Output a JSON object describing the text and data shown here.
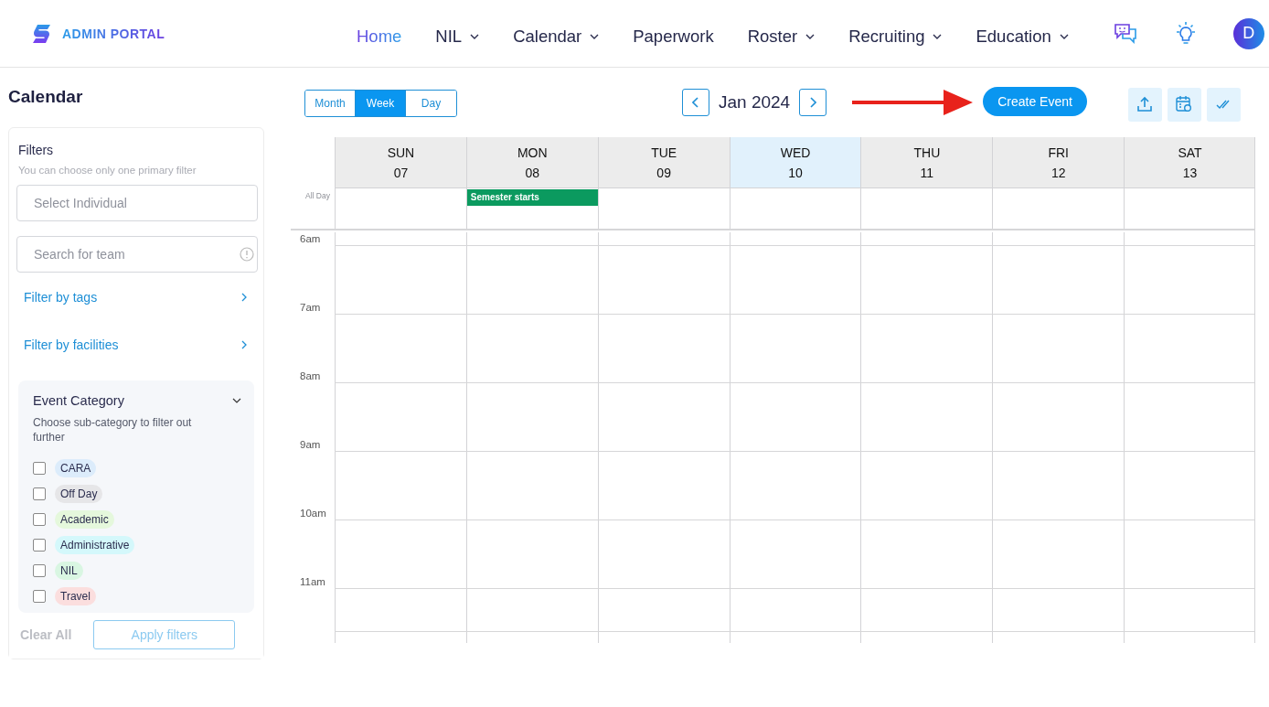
{
  "header": {
    "brand": "ADMIN PORTAL",
    "nav": [
      {
        "label": "Home",
        "selected": true,
        "dropdown": false
      },
      {
        "label": "NIL",
        "selected": false,
        "dropdown": true
      },
      {
        "label": "Calendar",
        "selected": false,
        "dropdown": true
      },
      {
        "label": "Paperwork",
        "selected": false,
        "dropdown": false
      },
      {
        "label": "Roster",
        "selected": false,
        "dropdown": true
      },
      {
        "label": "Recruiting",
        "selected": false,
        "dropdown": true
      },
      {
        "label": "Education",
        "selected": false,
        "dropdown": true
      }
    ],
    "avatar": "D"
  },
  "sidebar": {
    "title": "Calendar",
    "filters_title": "Filters",
    "filters_hint": "You can choose only one primary filter",
    "individual": {
      "placeholder": "Select Individual"
    },
    "team": {
      "placeholder": "Search for team"
    },
    "links": [
      "Filter by tags",
      "Filter by facilities"
    ],
    "category": {
      "title": "Event Category",
      "expanded": true,
      "hint": "Choose sub-category to filter out further",
      "items": [
        {
          "label": "CARA",
          "checked": false,
          "color": "#dcecfb"
        },
        {
          "label": "Off Day",
          "checked": false,
          "color": "#e6e6e8"
        },
        {
          "label": "Academic",
          "checked": false,
          "color": "#e5f8dc"
        },
        {
          "label": "Administrative",
          "checked": false,
          "color": "#d4f8fb"
        },
        {
          "label": "NIL",
          "checked": false,
          "color": "#d9f6e2"
        },
        {
          "label": "Travel",
          "checked": false,
          "color": "#fbdede"
        }
      ]
    },
    "clear": "Clear All",
    "apply": "Apply filters"
  },
  "toolbar": {
    "views": [
      {
        "label": "Month",
        "selected": false
      },
      {
        "label": "Week",
        "selected": true
      },
      {
        "label": "Day",
        "selected": false
      }
    ],
    "period": "Jan 2024",
    "create": "Create Event"
  },
  "calendar": {
    "days": [
      {
        "name": "SUN",
        "date": "07",
        "today": false
      },
      {
        "name": "MON",
        "date": "08",
        "today": false,
        "all_day_events": [
          {
            "title": "Semester starts",
            "color": "#0b9a5f"
          }
        ]
      },
      {
        "name": "TUE",
        "date": "09",
        "today": false
      },
      {
        "name": "WED",
        "date": "10",
        "today": true
      },
      {
        "name": "THU",
        "date": "11",
        "today": false
      },
      {
        "name": "FRI",
        "date": "12",
        "today": false
      },
      {
        "name": "SAT",
        "date": "13",
        "today": false
      }
    ],
    "all_day_label": "All Day",
    "hours": [
      "6am",
      "7am",
      "8am",
      "9am",
      "10am",
      "11am"
    ]
  }
}
